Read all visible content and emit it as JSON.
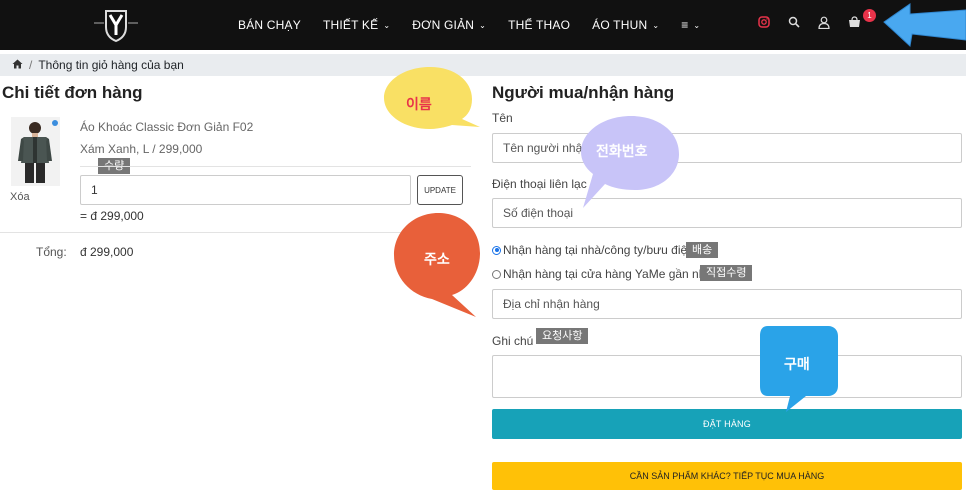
{
  "colors": {
    "navbar_bg": "#111111",
    "accent_teal": "#17a2b8",
    "accent_yellow": "#ffc107",
    "badge_red": "#e8334a",
    "tag_gray": "#777777",
    "bubble_yellow": "#f9e064",
    "bubble_lavender": "#c8c4f8",
    "bubble_orange": "#e8603a",
    "bubble_blue": "#2aa3e8",
    "arrow_blue": "#49a8f0"
  },
  "navbar": {
    "logo_icon": "y-shield-logo-icon",
    "items": [
      {
        "label": "BÁN CHẠY",
        "has_dropdown": false
      },
      {
        "label": "THIẾT KẾ",
        "has_dropdown": true
      },
      {
        "label": "ĐƠN GIẢN",
        "has_dropdown": true
      },
      {
        "label": "THỂ THAO",
        "has_dropdown": false
      },
      {
        "label": "ÁO THUN",
        "has_dropdown": true
      },
      {
        "label": "≡",
        "has_dropdown": true
      }
    ],
    "icons": [
      "instagram-icon",
      "search-icon",
      "user-icon",
      "cart-icon"
    ],
    "cart_count": "1"
  },
  "breadcrumb": {
    "home_icon": "home-icon",
    "separator": "/",
    "current": "Thông tin giỏ hàng của bạn"
  },
  "order": {
    "heading": "Chi tiết đơn hàng",
    "item": {
      "name": "Áo Khoác Classic Đơn Giản F02",
      "variant": "Xám Xanh, L / 299,000",
      "quantity_tag": "수량",
      "quantity": "1",
      "update_label": "UPDATE",
      "remove_label": "Xóa",
      "line_total": "= đ 299,000"
    },
    "total_label": "Tổng:",
    "total_value": "đ 299,000"
  },
  "buyer": {
    "heading": "Người mua/nhận hàng",
    "name_label": "Tên",
    "name_placeholder": "Tên người nhận",
    "phone_label": "Điện thoại liên lạc",
    "phone_placeholder": "Số điện thoại",
    "delivery_option_home": "Nhận hàng tại nhà/công ty/bưu điện",
    "delivery_tag_home": "배송",
    "delivery_option_store": "Nhận hàng tại cửa hàng YaMe gần nhất",
    "delivery_tag_store": "직접수령",
    "address_placeholder": "Địa chỉ nhận hàng",
    "note_label": "Ghi chú",
    "note_tag": "요청사항",
    "submit_label": "ĐẶT HÀNG",
    "continue_label": "CẦN SẢN PHẨM KHÁC? TIẾP TỤC MUA HÀNG"
  },
  "annotations": {
    "name_bubble": "이름",
    "phone_bubble": "전화번호",
    "address_bubble": "주소",
    "purchase_bubble": "구매"
  }
}
